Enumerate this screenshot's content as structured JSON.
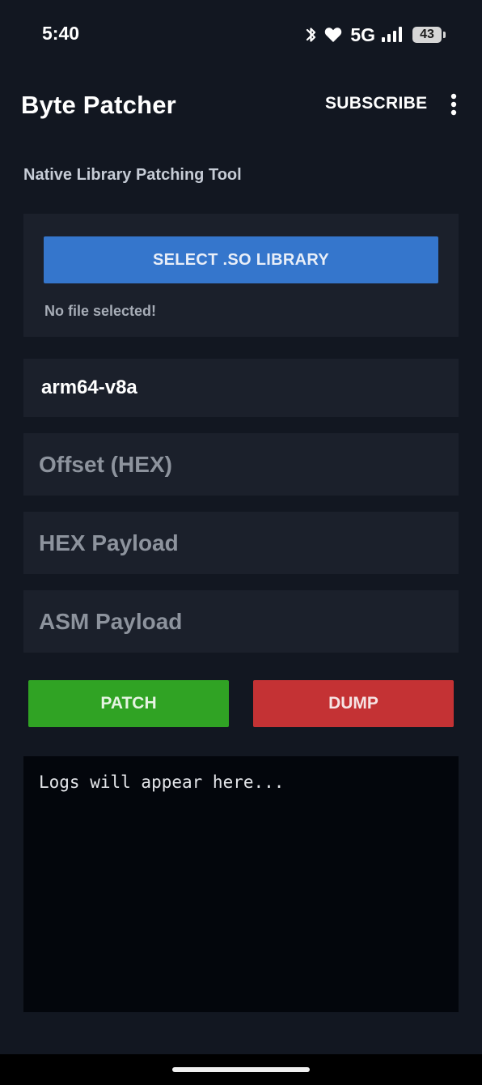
{
  "status_bar": {
    "time": "5:40",
    "network": "5G",
    "battery": "43",
    "icons": [
      "bluetooth-icon",
      "heart-icon",
      "signal-icon",
      "battery-icon"
    ]
  },
  "app_bar": {
    "title": "Byte Patcher",
    "subscribe_label": "SUBSCRIBE",
    "more_icon": "more-vert-icon"
  },
  "main": {
    "subtitle": "Native Library Patching Tool",
    "select_button_label": "SELECT .SO LIBRARY",
    "file_status": "No file selected!",
    "abi_value": "arm64-v8a",
    "offset_placeholder": "Offset (HEX)",
    "hex_placeholder": "HEX Payload",
    "asm_placeholder": "ASM Payload",
    "patch_label": "PATCH",
    "dump_label": "DUMP",
    "log_text": "Logs will appear here..."
  },
  "colors": {
    "background": "#121721",
    "card": "#1b202b",
    "select_button": "#3576cc",
    "patch_button": "#30a324",
    "dump_button": "#c43234",
    "log_background": "#03060c"
  }
}
